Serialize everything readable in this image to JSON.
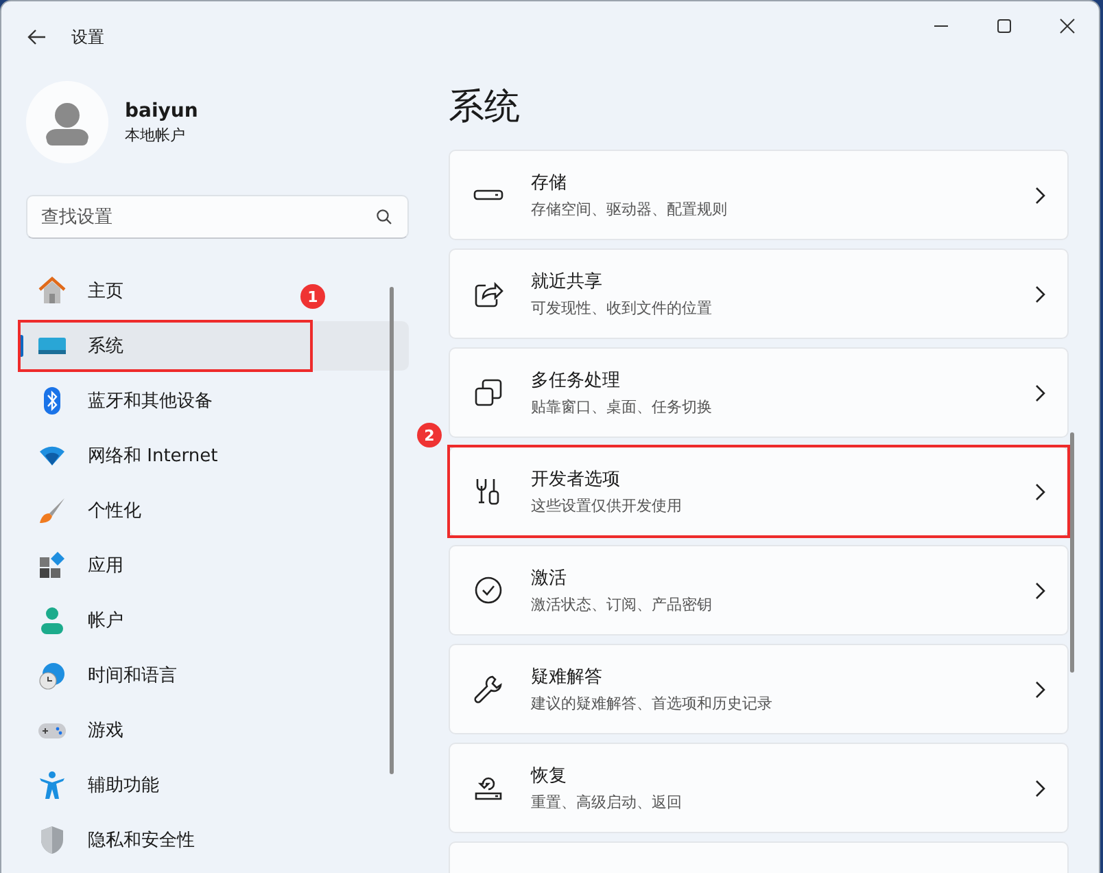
{
  "window": {
    "title": "设置"
  },
  "profile": {
    "name": "baiyun",
    "account_type": "本地帐户"
  },
  "search": {
    "placeholder": "查找设置"
  },
  "nav": [
    {
      "label": "主页",
      "selected": false,
      "highlighted": false
    },
    {
      "label": "系统",
      "selected": true,
      "highlighted": true,
      "callout": "1"
    },
    {
      "label": "蓝牙和其他设备",
      "selected": false,
      "highlighted": false
    },
    {
      "label": "网络和 Internet",
      "selected": false,
      "highlighted": false
    },
    {
      "label": "个性化",
      "selected": false,
      "highlighted": false
    },
    {
      "label": "应用",
      "selected": false,
      "highlighted": false
    },
    {
      "label": "帐户",
      "selected": false,
      "highlighted": false
    },
    {
      "label": "时间和语言",
      "selected": false,
      "highlighted": false
    },
    {
      "label": "游戏",
      "selected": false,
      "highlighted": false
    },
    {
      "label": "辅助功能",
      "selected": false,
      "highlighted": false
    },
    {
      "label": "隐私和安全性",
      "selected": false,
      "highlighted": false
    }
  ],
  "page_title": "系统",
  "settings": [
    {
      "title": "存储",
      "description": "存储空间、驱动器、配置规则",
      "highlighted": false
    },
    {
      "title": "就近共享",
      "description": "可发现性、收到文件的位置",
      "highlighted": false
    },
    {
      "title": "多任务处理",
      "description": "贴靠窗口、桌面、任务切换",
      "highlighted": false
    },
    {
      "title": "开发者选项",
      "description": "这些设置仅供开发使用",
      "highlighted": true,
      "callout": "2"
    },
    {
      "title": "激活",
      "description": "激活状态、订阅、产品密钥",
      "highlighted": false
    },
    {
      "title": "疑难解答",
      "description": "建议的疑难解答、首选项和历史记录",
      "highlighted": false
    },
    {
      "title": "恢复",
      "description": "重置、高级启动、返回",
      "highlighted": false
    }
  ]
}
